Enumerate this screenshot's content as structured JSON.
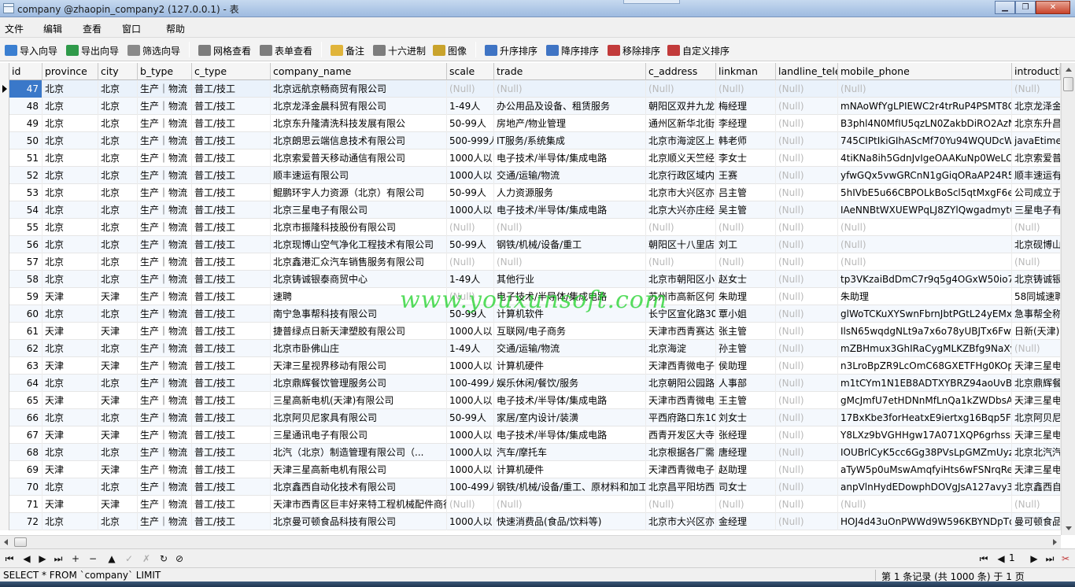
{
  "window": {
    "title": "company @zhaopin_company2 (127.0.0.1) - 表",
    "buttons": {
      "minimize": "▁",
      "maximize": "❐",
      "close": "✕"
    }
  },
  "menu": [
    "文件",
    "编辑",
    "查看",
    "窗口",
    "帮助"
  ],
  "toolbar": [
    {
      "label": "导入向导",
      "icon": "import-wizard-icon",
      "color": "#3b7fd1"
    },
    {
      "label": "导出向导",
      "icon": "export-wizard-icon",
      "color": "#2f9a4a"
    },
    {
      "label": "筛选向导",
      "icon": "filter-wizard-icon",
      "color": "#8a8a8a"
    },
    {
      "label": "网格查看",
      "icon": "grid-view-icon",
      "color": "#7d7d7d"
    },
    {
      "label": "表单查看",
      "icon": "form-view-icon",
      "color": "#7d7d7d"
    },
    {
      "label": "备注",
      "icon": "memo-icon",
      "color": "#e0b43a"
    },
    {
      "label": "十六进制",
      "icon": "hex-icon",
      "color": "#7d7d7d"
    },
    {
      "label": "图像",
      "icon": "image-icon",
      "color": "#c9a32c"
    },
    {
      "label": "升序排序",
      "icon": "sort-asc-icon",
      "color": "#3f74c4"
    },
    {
      "label": "降序排序",
      "icon": "sort-desc-icon",
      "color": "#3f74c4"
    },
    {
      "label": "移除排序",
      "icon": "remove-sort-icon",
      "color": "#c23b3b"
    },
    {
      "label": "自定义排序",
      "icon": "custom-sort-icon",
      "color": "#c23b3b"
    }
  ],
  "columns": [
    "id",
    "province",
    "city",
    "b_type",
    "c_type",
    "company_name",
    "scale",
    "trade",
    "c_address",
    "linkman",
    "landline_telep",
    "mobile_phone",
    "introducti"
  ],
  "rows": [
    [
      "47",
      "北京",
      "北京",
      "生产｜物流",
      "普工/技工",
      "北京远航京畅商贸有限公司",
      "(Null)",
      "(Null)",
      "(Null)",
      "(Null)",
      "(Null)",
      "(Null)",
      "(Null)"
    ],
    [
      "48",
      "北京",
      "北京",
      "生产｜物流",
      "普工/技工",
      "北京龙泽金晨科贸有限公司",
      "1-49人",
      "办公用品及设备、租赁服务",
      "朝阳区双井九龙",
      "梅经理",
      "(Null)",
      "mNAoWfYgLPIEWC2r4trRuP4PSMT8C",
      "北京龙泽金"
    ],
    [
      "49",
      "北京",
      "北京",
      "生产｜物流",
      "普工/技工",
      "北京东升隆清洗科技发展有限公",
      "50-99人",
      "房地产/物业管理",
      "通州区新华北街",
      "李经理",
      "(Null)",
      "B3phl4N0MfIU5qzLN0ZakbDiRO2AzN",
      "北京东升昌"
    ],
    [
      "50",
      "北京",
      "北京",
      "生产｜物流",
      "普工/技工",
      "北京朗思云端信息技术有限公司",
      "500-999人",
      "IT服务/系统集成",
      "北京市海淀区上",
      "韩老师",
      "(Null)",
      "745CIPtIkiGIhAScMf70Yu94WQUDcW",
      "javaEtime("
    ],
    [
      "51",
      "北京",
      "北京",
      "生产｜物流",
      "普工/技工",
      "北京索爱普天移动通信有限公司",
      "1000人以",
      "电子技术/半导体/集成电路",
      "北京顺义天竺经",
      "李女士",
      "(Null)",
      "4tiKNa8ih5GdnJvIgeOAAKuNp0WeLC",
      "北京索爱普"
    ],
    [
      "52",
      "北京",
      "北京",
      "生产｜物流",
      "普工/技工",
      "顺丰速运有限公司",
      "1000人以",
      "交通/运输/物流",
      "北京行政区域内",
      "王赛",
      "(Null)",
      "yfwGQx5vwGRCnN1gGiqORaAP24R5a",
      "顺丰速运有"
    ],
    [
      "53",
      "北京",
      "北京",
      "生产｜物流",
      "普工/技工",
      "鲲鹏环宇人力资源（北京）有限公司",
      "50-99人",
      "人力资源服务",
      "北京市大兴区亦",
      "吕主管",
      "(Null)",
      "5hIVbE5u66CBPOLkBoScl5qtMxgF6e",
      "公司成立于"
    ],
    [
      "54",
      "北京",
      "北京",
      "生产｜物流",
      "普工/技工",
      "北京三星电子有限公司",
      "1000人以",
      "电子技术/半导体/集成电路",
      "北京大兴亦庄经",
      "吴主管",
      "(Null)",
      "IAeNNBtWXUEWPqLJ8ZYlQwgadmytC",
      "三星电子有"
    ],
    [
      "55",
      "北京",
      "北京",
      "生产｜物流",
      "普工/技工",
      "北京市振隆科技股份有限公司",
      "(Null)",
      "(Null)",
      "(Null)",
      "(Null)",
      "(Null)",
      "(Null)",
      "(Null)"
    ],
    [
      "56",
      "北京",
      "北京",
      "生产｜物流",
      "普工/技工",
      "北京现博山空气净化工程技术有限公司",
      "50-99人",
      "钢铁/机械/设备/重工",
      "朝阳区十八里店",
      "刘工",
      "(Null)",
      "(Null)",
      "北京砚博山"
    ],
    [
      "57",
      "北京",
      "北京",
      "生产｜物流",
      "普工/技工",
      "北京鑫港汇众汽车销售服务有限公司",
      "(Null)",
      "(Null)",
      "(Null)",
      "(Null)",
      "(Null)",
      "(Null)",
      "(Null)"
    ],
    [
      "58",
      "北京",
      "北京",
      "生产｜物流",
      "普工/技工",
      "北京铸诚银泰商贸中心",
      "1-49人",
      "其他行业",
      "北京市朝阳区小",
      "赵女士",
      "(Null)",
      "tp3VKzaiBdDmC7r9q5g4OGxW50io7y",
      "北京铸诚银"
    ],
    [
      "59",
      "天津",
      "天津",
      "生产｜物流",
      "普工/技工",
      "速聘",
      "(Null)",
      "电子技术/半导体/集成电路",
      "苏州市高新区何",
      "朱助理",
      "(Null)",
      "朱助理",
      "58同城速聘"
    ],
    [
      "60",
      "北京",
      "北京",
      "生产｜物流",
      "普工/技工",
      "南宁急事帮科技有限公司",
      "50-99人",
      "计算机软件",
      "长宁区宣化路30",
      "覃小姐",
      "(Null)",
      "glWoTCKuXYSwnFbrnJbtPGtL24yEMxv",
      "急事帮全称"
    ],
    [
      "61",
      "天津",
      "天津",
      "生产｜物流",
      "普工/技工",
      "捷普绿点日新天津塑胶有限公司",
      "1000人以",
      "互联网/电子商务",
      "天津市西青赛达",
      "张主管",
      "(Null)",
      "IlsN65wqdgNLt9a7x6o78yUBJTx6Fwc",
      "日新(天津)"
    ],
    [
      "62",
      "北京",
      "北京",
      "生产｜物流",
      "普工/技工",
      "北京市卧佛山庄",
      "1-49人",
      "交通/运输/物流",
      "北京海淀",
      "孙主管",
      "(Null)",
      "mZBHmux3GhIRaCygMLKZBfg9NaXy",
      "(Null)"
    ],
    [
      "63",
      "天津",
      "天津",
      "生产｜物流",
      "普工/技工",
      "天津三星视界移动有限公司",
      "1000人以",
      "计算机硬件",
      "天津西青微电子",
      "侯助理",
      "(Null)",
      "n3LroBpZR9LcOmC68GXETFHg0KOpv",
      "天津三星电"
    ],
    [
      "64",
      "北京",
      "北京",
      "生产｜物流",
      "普工/技工",
      "北京鼎辉餐饮管理服务公司",
      "100-499人",
      "娱乐休闲/餐饮/服务",
      "北京朝阳公园路",
      "人事部",
      "(Null)",
      "m1tCYm1N1EB8ADTXYBRZ94aoUvBP",
      "北京鼎辉餐"
    ],
    [
      "65",
      "天津",
      "天津",
      "生产｜物流",
      "普工/技工",
      "三星高新电机(天津)有限公司",
      "1000人以",
      "电子技术/半导体/集成电路",
      "天津市西青微电",
      "王主管",
      "(Null)",
      "gMcJmfU7etHDNnMfLnQa1kZWDbsA",
      "天津三星电"
    ],
    [
      "66",
      "北京",
      "北京",
      "生产｜物流",
      "普工/技工",
      "北京阿贝尼家具有限公司",
      "50-99人",
      "家居/室内设计/装潢",
      "平西府路口东10",
      "刘女士",
      "(Null)",
      "17BxKbe3forHeatxE9iertxg16Bqp5F2",
      "北京阿贝尼"
    ],
    [
      "67",
      "天津",
      "天津",
      "生产｜物流",
      "普工/技工",
      "三星通讯电子有限公司",
      "1000人以",
      "电子技术/半导体/集成电路",
      "西青开发区大寺",
      "张经理",
      "(Null)",
      "Y8LXz9bVGHHgw17A071XQP6grhssrr",
      "天津三星电"
    ],
    [
      "68",
      "北京",
      "北京",
      "生产｜物流",
      "普工/技工",
      "北汽（北京）制造管理有限公司（...",
      "1000人以",
      "汽车/摩托车",
      "北京根据各厂需",
      "唐经理",
      "(Null)",
      "IOUBrlCyK5cc6Gg38PVsLpGMZmUyzp",
      "北京北汽汽"
    ],
    [
      "69",
      "天津",
      "天津",
      "生产｜物流",
      "普工/技工",
      "天津三星高新电机有限公司",
      "1000人以",
      "计算机硬件",
      "天津西青微电子",
      "赵助理",
      "(Null)",
      "aTyW5p0uMswAmqfyiHts6wFSNrqRe",
      "天津三星电"
    ],
    [
      "70",
      "北京",
      "北京",
      "生产｜物流",
      "普工/技工",
      "北京鑫西自动化技术有限公司",
      "100-499人",
      "钢铁/机械/设备/重工、原材料和加工",
      "北京昌平阳坊西",
      "司女士",
      "(Null)",
      "anpVlnHydEDowphDOVgJsA127avy3L",
      "北京鑫西自"
    ],
    [
      "71",
      "天津",
      "天津",
      "生产｜物流",
      "普工/技工",
      "天津市西青区巨丰好来特工程机械配件商行",
      "(Null)",
      "(Null)",
      "(Null)",
      "(Null)",
      "(Null)",
      "(Null)",
      "(Null)"
    ],
    [
      "72",
      "北京",
      "北京",
      "生产｜物流",
      "普工/技工",
      "北京曼可顿食品科技有限公司",
      "1000人以",
      "快速消费品(食品/饮料等)",
      "北京市大兴区亦",
      "金经理",
      "(Null)",
      "HOJ4d43uOnPWWd9W596KBYNDpTq",
      "曼可顿食品"
    ]
  ],
  "navigation": {
    "first": "⏮",
    "prev": "◀",
    "next": "▶",
    "last": "⏭",
    "add": "+",
    "delete": "−",
    "up": "▲",
    "apply": "✓",
    "cancel": "✗",
    "refresh": "↻",
    "stop": "⊘",
    "page": "1"
  },
  "status": {
    "sql": "SELECT * FROM `company` LIMIT",
    "record_info": "第 1 条记录 (共 1000 条) 于 1 页"
  },
  "watermark": "www.youxunsoft.com"
}
